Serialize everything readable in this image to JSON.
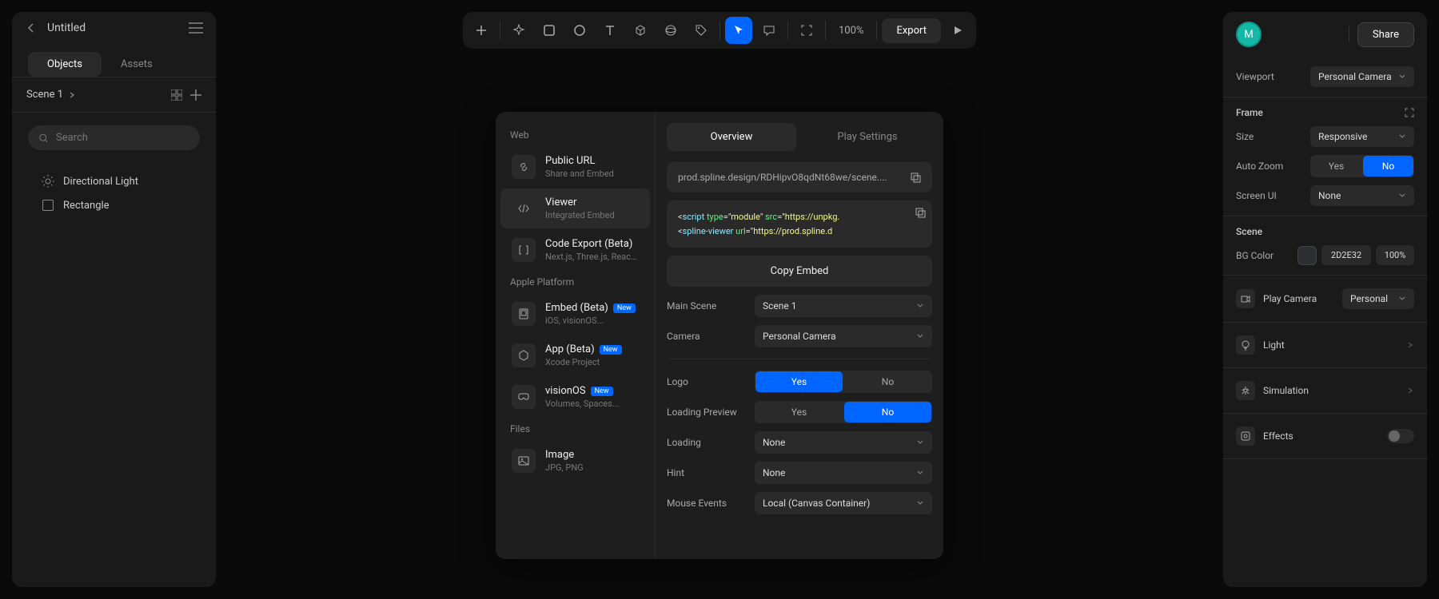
{
  "header": {
    "project_title": "Untitled"
  },
  "left_tabs": {
    "objects": "Objects",
    "assets": "Assets"
  },
  "scene": {
    "label": "Scene 1"
  },
  "search": {
    "placeholder": "Search"
  },
  "layers": [
    {
      "name": "Directional Light",
      "icon": "light"
    },
    {
      "name": "Rectangle",
      "icon": "rect"
    }
  ],
  "toolbar": {
    "zoom": "100%",
    "export": "Export"
  },
  "modal": {
    "sections": {
      "web": "Web",
      "apple": "Apple Platform",
      "files": "Files"
    },
    "items": {
      "public_url": {
        "title": "Public URL",
        "sub": "Share and Embed"
      },
      "viewer": {
        "title": "Viewer",
        "sub": "Integrated Embed"
      },
      "code_export": {
        "title": "Code Export (Beta)",
        "sub": "Next.js, Three.js, React..."
      },
      "embed_beta": {
        "title": "Embed (Beta)",
        "badge": "New",
        "sub": "iOS, visionOS..."
      },
      "app_beta": {
        "title": "App (Beta)",
        "badge": "New",
        "sub": "Xcode Project"
      },
      "visionos": {
        "title": "visionOS",
        "badge": "New",
        "sub": "Volumes, Spaces..."
      },
      "image": {
        "title": "Image",
        "sub": "JPG, PNG"
      }
    },
    "tabs": {
      "overview": "Overview",
      "play_settings": "Play Settings"
    },
    "url": "prod.spline.design/RDHipvO8qdNt68we/scene....",
    "code": {
      "l1_pre": "<",
      "l1_tag": "script",
      "l1_attr1": "type",
      "l1_val1": "\"module\"",
      "l1_attr2": "src",
      "l1_val2": "\"https://unpkg.",
      "l2_pre": "<",
      "l2_tag": "spline-viewer",
      "l2_attr1": "url",
      "l2_val1": "\"https://prod.spline.d"
    },
    "copy_embed": "Copy Embed",
    "settings": {
      "main_scene": {
        "label": "Main Scene",
        "value": "Scene 1"
      },
      "camera": {
        "label": "Camera",
        "value": "Personal Camera"
      },
      "logo": {
        "label": "Logo",
        "yes": "Yes",
        "no": "No"
      },
      "loading_preview": {
        "label": "Loading Preview",
        "yes": "Yes",
        "no": "No"
      },
      "loading": {
        "label": "Loading",
        "value": "None"
      },
      "hint": {
        "label": "Hint",
        "value": "None"
      },
      "mouse_events": {
        "label": "Mouse Events",
        "value": "Local (Canvas Container)"
      }
    }
  },
  "right": {
    "avatar": "M",
    "share": "Share",
    "viewport": {
      "label": "Viewport",
      "value": "Personal Camera"
    },
    "frame": {
      "title": "Frame",
      "size": {
        "label": "Size",
        "value": "Responsive"
      },
      "auto_zoom": {
        "label": "Auto Zoom",
        "yes": "Yes",
        "no": "No"
      },
      "screen_ui": {
        "label": "Screen UI",
        "value": "None"
      }
    },
    "scene_section": {
      "title": "Scene",
      "bg_color": {
        "label": "BG Color",
        "hex": "2D2E32",
        "pct": "100%"
      }
    },
    "features": {
      "play_camera": {
        "label": "Play Camera",
        "value": "Personal"
      },
      "light": "Light",
      "simulation": "Simulation",
      "effects": "Effects"
    }
  }
}
